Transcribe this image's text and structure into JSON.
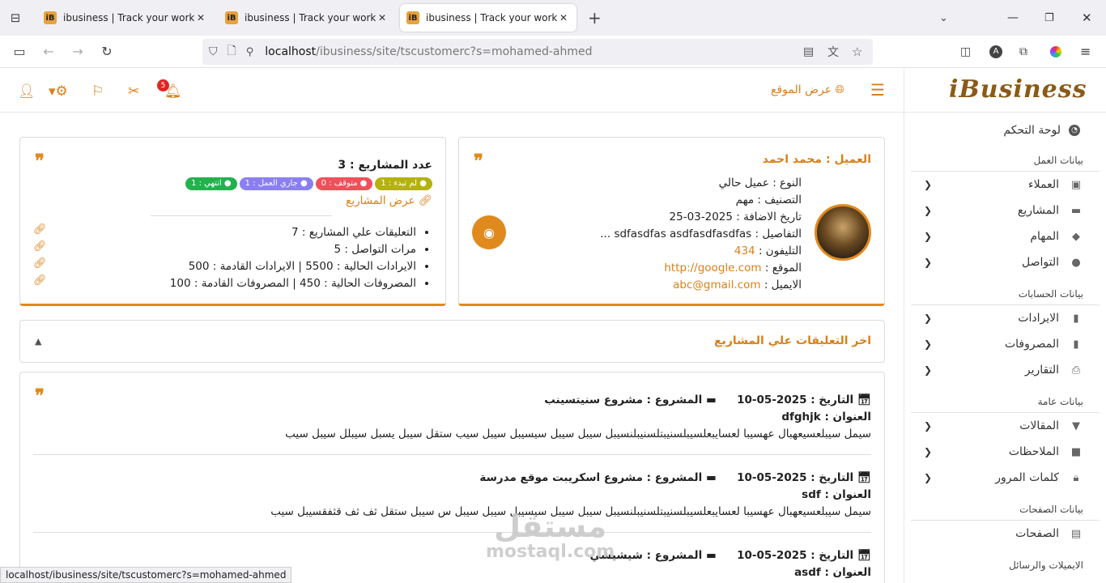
{
  "browser": {
    "tabs": [
      {
        "title": "ibusiness | Track your work with"
      },
      {
        "title": "ibusiness | Track your work with"
      },
      {
        "title": "ibusiness | Track your work with"
      }
    ],
    "url_host": "localhost",
    "url_path": "/ibusiness/site/tscustomerc?s=mohamed-ahmed",
    "status_url": "localhost/ibusiness/site/tscustomerc?s=mohamed-ahmed"
  },
  "header": {
    "logo": "iBusiness",
    "view_site": "عرض الموقع",
    "notifications_count": "5"
  },
  "sidebar": {
    "dashboard": "لوحة التحكم",
    "sections": [
      {
        "title": "بيانات العمل",
        "items": [
          {
            "label": "العملاء",
            "icon": "id-card-icon"
          },
          {
            "label": "المشاريع",
            "icon": "folder-icon"
          },
          {
            "label": "المهام",
            "icon": "tags-icon"
          },
          {
            "label": "التواصل",
            "icon": "comments-icon"
          }
        ]
      },
      {
        "title": "بيانات الحسابات",
        "items": [
          {
            "label": "الايرادات",
            "icon": "book-icon"
          },
          {
            "label": "المصروفات",
            "icon": "book-icon"
          },
          {
            "label": "التقارير",
            "icon": "print-icon"
          }
        ]
      },
      {
        "title": "بيانات عامة",
        "items": [
          {
            "label": "المقالات",
            "icon": "bookmark-icon"
          },
          {
            "label": "الملاحظات",
            "icon": "note-icon"
          },
          {
            "label": "كلمات المرور",
            "icon": "lock-icon"
          }
        ]
      },
      {
        "title": "بيانات الصفحات",
        "items": [
          {
            "label": "الصفحات",
            "icon": "file-icon"
          }
        ]
      },
      {
        "title": "الايميلات والرسائل",
        "items": []
      }
    ]
  },
  "customer": {
    "title": "العميل : محمد احمد",
    "type": "النوع : عميل حالي",
    "classification": "التصنيف : مهم",
    "added": "تاريخ الاضافة : 2025-03-25",
    "details": "التفاصيل : sdfasdfas asdfasdfasdfas ...",
    "phone_label": "التليفون :",
    "phone": "434",
    "site_label": "الموقع :",
    "site": "http://google.com",
    "email_label": "الايميل :",
    "email": "abc@gmail.com"
  },
  "projects": {
    "count": "عدد المشاريع : 3",
    "badges": [
      {
        "label": "لم تبدء : 1",
        "color": "#b5b20e"
      },
      {
        "label": "متوقف : 0",
        "color": "#f0505a"
      },
      {
        "label": "جاري العمل : 1",
        "color": "#8a7ff0"
      },
      {
        "label": "انتهي : 1",
        "color": "#22b24c"
      }
    ],
    "view_projects": "عرض المشاريع",
    "stats": [
      "التعليقات علي المشاريع : 7",
      "مرات التواصل : 5",
      "الايرادات الحالية : 5500 | الايرادات القادمة : 500",
      "المصروفات الحالية : 450 | المصروفات القادمة : 100"
    ]
  },
  "comments": {
    "heading": "اخر التعليقات علي المشاريع",
    "items": [
      {
        "date": "التاريخ : 2025-05-10",
        "project": "المشروع : مشروع سنيتسينب",
        "subject": "العنوان : dfghjk",
        "body": "سيمل سيبلعسيعهبال عهسيبا لعسايبعلسيبلسنيبتلسنيبلنسيبل سيبل سيبل سيسيبل سيبل سيب ستقل سيبل يسبل سيبلل سيبل سيب"
      },
      {
        "date": "التاريخ : 2025-05-10",
        "project": "المشروع : مشروع اسكريبت موقع مدرسة",
        "subject": "العنوان : sdf",
        "body": "سيمل سيبلعسيعهبال عهسيبا لعسايبعلسيبلسنيبتلسنيبلنسيبل سيبل سيبل سيسيبل سيبل سيبل س سيبل ستقل ثف ثف قثفقسيبل سيب"
      },
      {
        "date": "التاريخ : 2025-05-10",
        "project": "المشروع : شيشيشي",
        "subject": "العنوان : asdf",
        "body": ""
      }
    ]
  },
  "watermark": {
    "arabic": "مستقل",
    "latin": "mostaql.com"
  }
}
